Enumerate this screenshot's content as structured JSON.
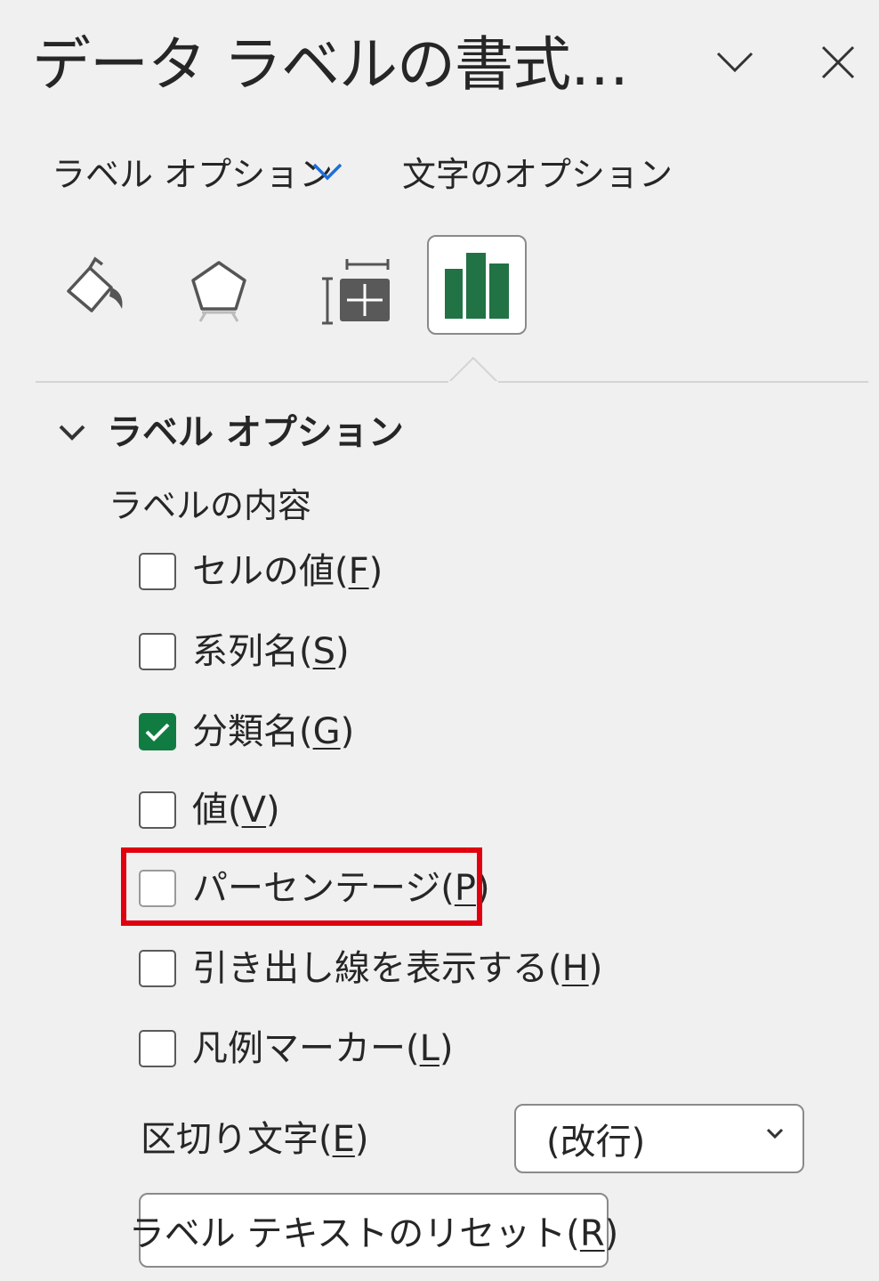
{
  "header": {
    "title": "データ ラベルの書式…",
    "collapse_icon": "chevron-down-icon",
    "close_icon": "close-icon"
  },
  "tabs": {
    "label_options": "ラベル オプション",
    "text_options": "文字のオプション"
  },
  "icon_tabs": [
    {
      "name": "fill-line-icon"
    },
    {
      "name": "effects-icon"
    },
    {
      "name": "size-properties-icon"
    },
    {
      "name": "label-options-icon",
      "active": true
    }
  ],
  "section": {
    "title": "ラベル オプション",
    "subtitle": "ラベルの内容"
  },
  "checkboxes": [
    {
      "label": "セルの値(",
      "key": "F",
      "suffix": ")",
      "checked": false
    },
    {
      "label": "系列名(",
      "key": "S",
      "suffix": ")",
      "checked": false
    },
    {
      "label": "分類名(",
      "key": "G",
      "suffix": ")",
      "checked": true
    },
    {
      "label": "値(",
      "key": "V",
      "suffix": ")",
      "checked": false
    },
    {
      "label": "パーセンテージ(",
      "key": "P",
      "suffix": ")",
      "checked": false
    },
    {
      "label": "引き出し線を表示する(",
      "key": "H",
      "suffix": ")",
      "checked": false
    },
    {
      "label": "凡例マーカー(",
      "key": "L",
      "suffix": ")",
      "checked": false
    }
  ],
  "separator": {
    "label": "区切り文字(",
    "key": "E",
    "suffix": ")",
    "value": "(改行)"
  },
  "reset_button": {
    "label": "ラベル テキストのリセット(",
    "key": "R",
    "suffix": ")"
  },
  "colors": {
    "accent_green": "#107c41",
    "highlight_red": "#e0000f",
    "tab_chevron_blue": "#1e6fd9"
  }
}
